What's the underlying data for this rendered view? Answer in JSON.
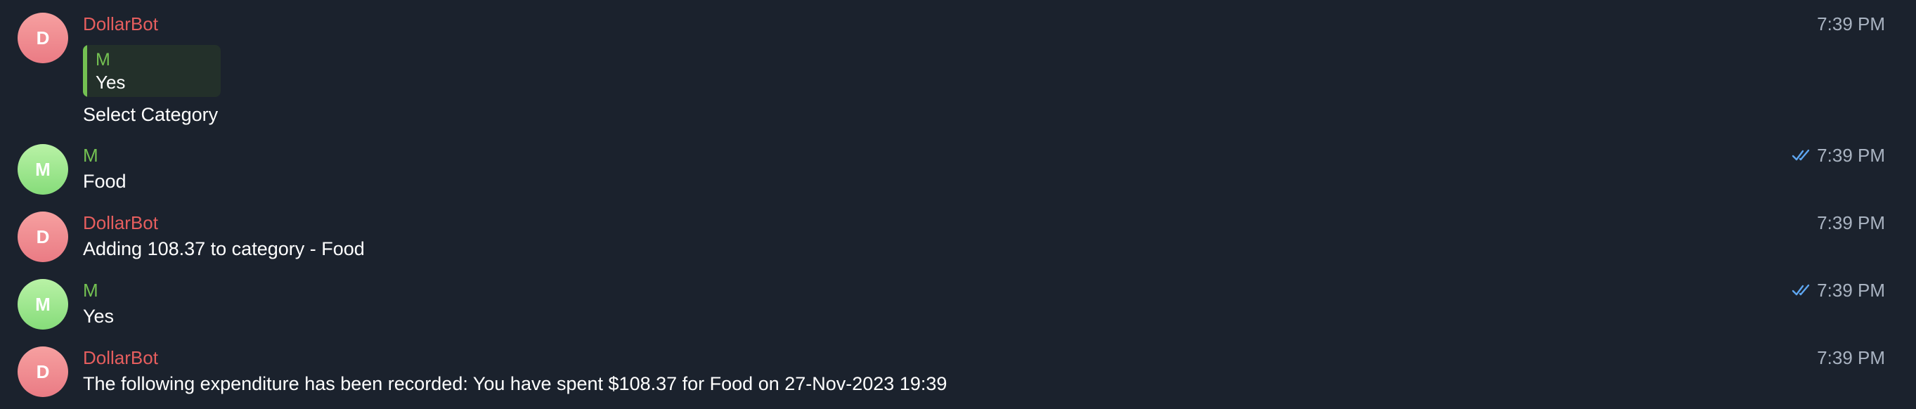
{
  "messages": [
    {
      "sender": "DollarBot",
      "avatar_initial": "D",
      "time": "7:39 PM",
      "reply": {
        "name": "M",
        "text": "Yes"
      },
      "text": "Select Category"
    },
    {
      "sender": "M",
      "avatar_initial": "M",
      "time": "7:39 PM",
      "text": "Food",
      "read_icon": "double-check-icon"
    },
    {
      "sender": "DollarBot",
      "avatar_initial": "D",
      "time": "7:39 PM",
      "text": "Adding 108.37 to category - Food"
    },
    {
      "sender": "M",
      "avatar_initial": "M",
      "time": "7:39 PM",
      "text": "Yes",
      "read_icon": "double-check-icon"
    },
    {
      "sender": "DollarBot",
      "avatar_initial": "D",
      "time": "7:39 PM",
      "text": "The following expenditure has been recorded: You have spent $108.37 for Food on 27-Nov-2023 19:39"
    }
  ],
  "colors": {
    "background": "#1b222d",
    "bot_name": "#e65e5e",
    "user_name": "#74c152",
    "time": "#a9b3c1",
    "read_check": "#5ea6f0"
  }
}
